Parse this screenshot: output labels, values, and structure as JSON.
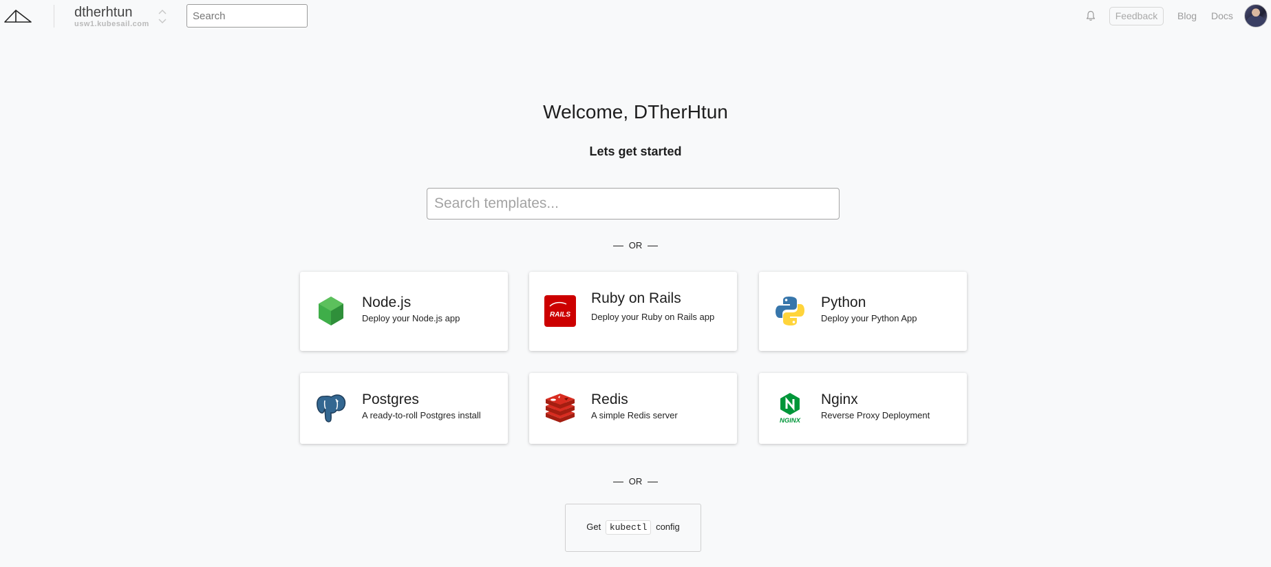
{
  "header": {
    "context_name": "dtherhtun",
    "context_host": "usw1.kubesail.com",
    "search_placeholder": "Search",
    "feedback_label": "Feedback",
    "blog_label": "Blog",
    "docs_label": "Docs",
    "icons": [
      "kubesail-logo-icon",
      "context-toggle-icon",
      "bell-icon",
      "avatar"
    ]
  },
  "main": {
    "welcome": "Welcome, DTherHtun",
    "subtitle": "Lets get started",
    "template_search_placeholder": "Search templates...",
    "or_label": "OR",
    "templates": [
      {
        "title": "Node.js",
        "description": "Deploy your Node.js app",
        "icon": "nodejs-icon"
      },
      {
        "title": "Ruby on Rails",
        "description": "Deploy your Ruby on Rails app",
        "icon": "rails-icon"
      },
      {
        "title": "Python",
        "description": "Deploy your Python App",
        "icon": "python-icon"
      },
      {
        "title": "Postgres",
        "description": "A ready-to-roll Postgres install",
        "icon": "postgres-icon"
      },
      {
        "title": "Redis",
        "description": "A simple Redis server",
        "icon": "redis-icon"
      },
      {
        "title": "Nginx",
        "description": "Reverse Proxy Deployment",
        "icon": "nginx-icon"
      }
    ],
    "kubectl": {
      "prefix": "Get",
      "code": "kubectl",
      "suffix": "config"
    },
    "rails_logo_text": "RAILS",
    "nginx_logo_text": "NGINX"
  },
  "colors": {
    "background": "#f8f9fa",
    "nodejs": "#3fae49",
    "rails": "#cc0000",
    "redis": "#c6302b",
    "nginx": "#009639",
    "postgres": "#336791",
    "python_blue": "#3776ab",
    "python_yellow": "#ffd43b"
  }
}
